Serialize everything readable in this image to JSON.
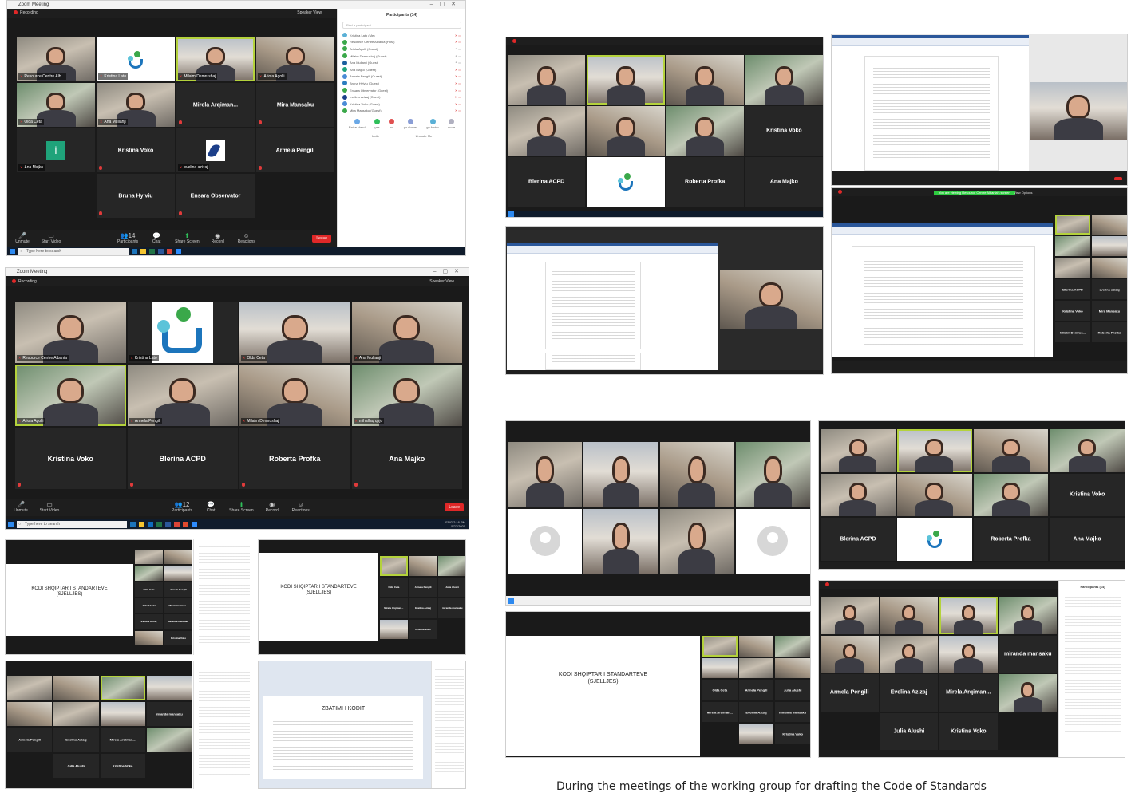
{
  "shot1": {
    "title": "Zoom Meeting",
    "recording": "Recording",
    "view": "Speaker View",
    "tiles": [
      {
        "label": "Resource Centre Alb..."
      },
      {
        "label": "Kristina Lato"
      },
      {
        "label": "Milaim Demrushaj"
      },
      {
        "label": "Ariola Agolli"
      },
      {
        "label": "Olda Ceta"
      },
      {
        "label": "Ana Mullanji"
      },
      {
        "name": "Mirela Arqiman..."
      },
      {
        "name": "Mira Mansaku"
      },
      {
        "label": "Ana Majko"
      },
      {
        "name": "Kristina Voko"
      },
      {
        "label": "evelina azizaj"
      },
      {
        "name": "Armela Pengili"
      },
      {
        "name": "Bruna Hylviu"
      },
      {
        "name": "Ensara Observator"
      }
    ],
    "participants_title": "Participants (14)",
    "find_placeholder": "Find a participant",
    "participants": [
      {
        "name": "Kristina Lato (Me)",
        "color": "#5ab0d6"
      },
      {
        "name": "Resource Centre Albania (Host)",
        "color": "#3aa84a"
      },
      {
        "name": "Ariola Agolli (Guest)",
        "color": "#3aa84a"
      },
      {
        "name": "Milaim Demrushaj (Guest)",
        "color": "#3aa84a"
      },
      {
        "name": "Ana Mullanji (Guest)",
        "color": "#1c5f9e"
      },
      {
        "name": "Ana Majko (Guest)",
        "color": "#1fa37a"
      },
      {
        "name": "Armela Pengili (Guest)",
        "color": "#4a8bd6"
      },
      {
        "name": "Bruna Hylviu (Guest)",
        "color": "#2c7dbf"
      },
      {
        "name": "Ensara Observator (Guest)",
        "color": "#3aa84a"
      },
      {
        "name": "evelina azizaj (Guest)",
        "color": "#1c3f8a"
      },
      {
        "name": "Kristina Voko (Guest)",
        "color": "#4a8bd6"
      },
      {
        "name": "Mira Mansaku (Guest)",
        "color": "#3aa84a"
      }
    ],
    "reactions": [
      "Raise Hand",
      "yes",
      "no",
      "go slower",
      "go faster",
      "more"
    ],
    "panel_buttons": [
      "Invite",
      "Unmute Me"
    ],
    "toolbar": [
      "Unmute",
      "Start Video",
      "Participants",
      "Chat",
      "Share Screen",
      "Record",
      "Reactions"
    ],
    "participants_count": "14",
    "leave": "Leave",
    "search": "Type here to search"
  },
  "shot2": {
    "title": "Zoom Meeting",
    "recording": "Recording",
    "view": "Speaker View",
    "tiles": [
      {
        "label": "Resource Centre Albania"
      },
      {
        "label": "Kristina Lato"
      },
      {
        "label": "Olda Ceta"
      },
      {
        "label": "Ana Mullanji"
      },
      {
        "label": "Ariola Agolli"
      },
      {
        "label": "Armela Pengili"
      },
      {
        "label": "Milaim Demrushaj"
      },
      {
        "label": "mihallaq qirjo"
      },
      {
        "name": "Kristina Voko"
      },
      {
        "name": "Blerina ACPD"
      },
      {
        "name": "Roberta Profka"
      },
      {
        "name": "Ana Majko"
      }
    ],
    "toolbar": [
      "Unmute",
      "Start Video",
      "Participants",
      "Chat",
      "Share Screen",
      "Record",
      "Reactions"
    ],
    "participants_count": "12",
    "leave": "Leave",
    "search": "Type here to search",
    "lang": "ENG",
    "time": "2:16 PM",
    "date": "5/27/2020"
  },
  "shot3": {
    "names": [
      "Kristina Voko",
      "Blerina ACPD",
      "Roberta Profka",
      "Ana Majko"
    ]
  },
  "shot5": {
    "names": [
      "Blerina ACPD",
      "evelina azizaj",
      "Kristina Voko",
      "Mira Mansaku",
      "Milaim Demrus...",
      "Roberta Profka"
    ],
    "green_banner": "You are viewing Resource Centre Albania's screen",
    "view_options": "View Options"
  },
  "slides": {
    "title_line1": "KODI SHQIPTAR I STANDARTEVE",
    "title_line2": "(SJELLJES)",
    "title_alt": "ZBATIMI I KODIT"
  },
  "smallgrid": {
    "names_a": [
      "Olda Ceta",
      "Armela Pengili",
      "Julia Alushi",
      "Mirela Arqiman...",
      "Evelina Azizaj",
      "miranda mansaku",
      "Kristina Voko"
    ],
    "names_b": [
      "Armela Pengili",
      "Evelina Azizaj",
      "Mirela Arqiman...",
      "Julia Alushi",
      "Kristina Voko",
      "miranda mansaku"
    ]
  },
  "shot8": {
    "names": [
      "Kristina Voko",
      "Blerina ACPD",
      "Roberta Profka",
      "Ana Majko"
    ]
  },
  "shot9": {
    "names": [
      "miranda mansaku",
      "Armela Pengili",
      "Evelina Azizaj",
      "Mirela Arqiman...",
      "Julia Alushi",
      "Kristina Voko"
    ],
    "participants_title": "Participants (14)"
  },
  "caption": "During the meetings of the working group for drafting the Code of Standards"
}
